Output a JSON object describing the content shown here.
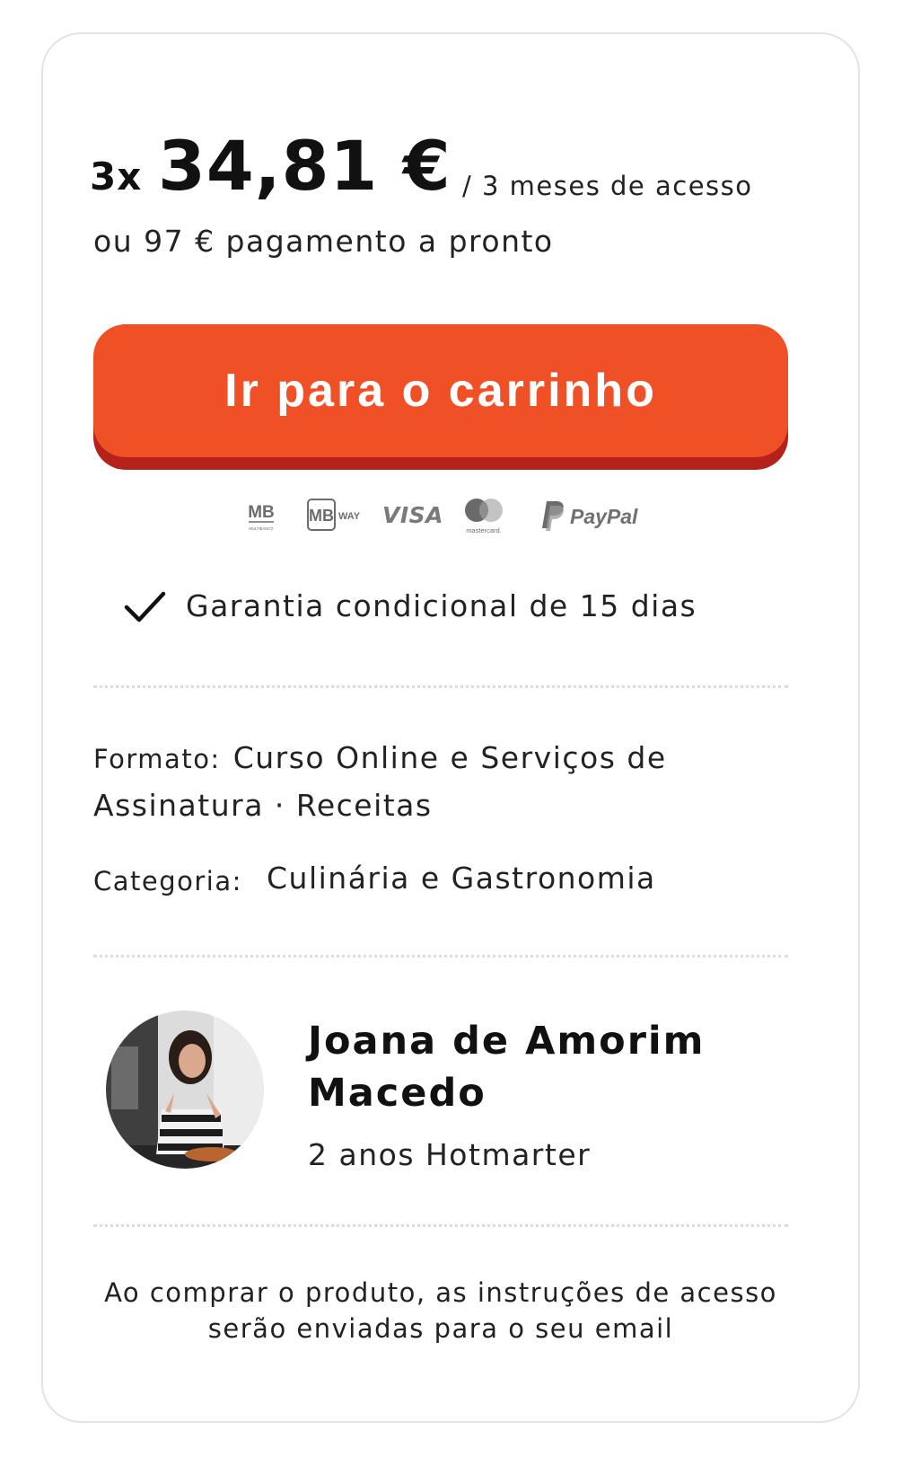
{
  "offer": {
    "installments_prefix": "3x",
    "installment_price": "34,81 €",
    "period": "/ 3 meses de acesso",
    "alternative": "ou 97 € pagamento a pronto"
  },
  "cta": {
    "label": "Ir para o carrinho"
  },
  "payment_methods": {
    "multibanco": {
      "logo": "MB",
      "caption": "MULTIBANCO"
    },
    "mbway": {
      "logo": "MB",
      "suffix": "WAY"
    },
    "visa": {
      "label": "VISA"
    },
    "mastercard": {
      "caption": "mastercard."
    },
    "paypal": {
      "label": "PayPal"
    }
  },
  "guarantee": {
    "icon": "check-icon",
    "text": "Garantia condicional de 15 dias"
  },
  "details": {
    "format_label": "Formato:",
    "format_value": "Curso Online e Serviços de Assinatura · Receitas",
    "category_label": "Categoria:",
    "category_value": "Culinária e Gastronomia"
  },
  "author": {
    "name": "Joana de Amorim Macedo",
    "tenure": "2 anos Hotmarter"
  },
  "note": "Ao comprar o produto, as instruções de acesso serão enviadas para o seu email",
  "colors": {
    "cta": "#f05025",
    "cta_shadow": "#b5221c",
    "card_border": "#e3e3e3",
    "divider": "#dcdcdc",
    "text": "#111111",
    "logos": "#6c6c6c"
  }
}
